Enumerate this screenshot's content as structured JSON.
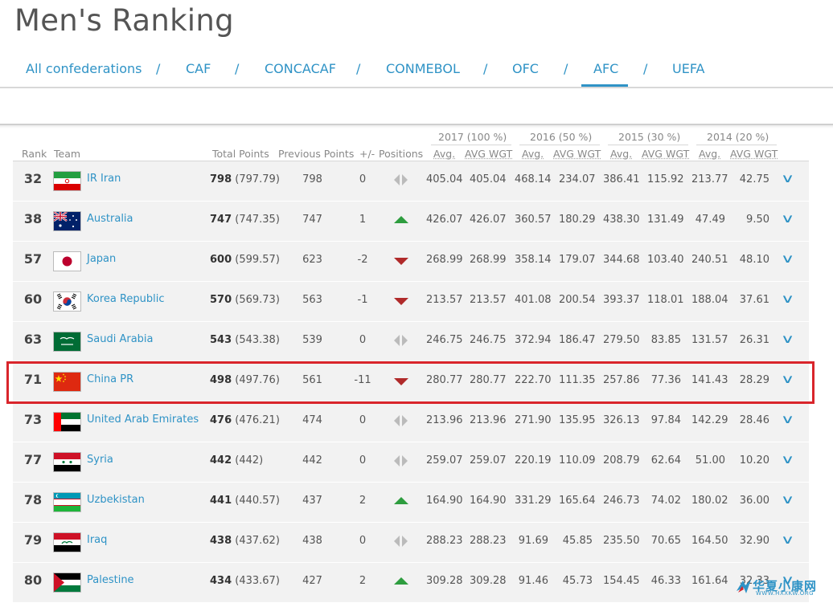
{
  "title": "Men's Ranking",
  "confederations": [
    {
      "label": "All confederations",
      "active": false
    },
    {
      "label": "CAF",
      "active": false
    },
    {
      "label": "CONCACAF",
      "active": false
    },
    {
      "label": "CONMEBOL",
      "active": false
    },
    {
      "label": "OFC",
      "active": false
    },
    {
      "label": "AFC",
      "active": true
    },
    {
      "label": "UEFA",
      "active": false
    }
  ],
  "separator": "/",
  "columns": {
    "rank": "Rank",
    "team": "Team",
    "total": "Total Points",
    "previous": "Previous Points",
    "diff": "+/-",
    "positions": "Positions"
  },
  "year_groups": [
    "2017 (100 %)",
    "2016 (50 %)",
    "2015 (30 %)",
    "2014 (20 %)"
  ],
  "sub_headers": [
    "Avg.",
    "AVG WGT"
  ],
  "rows": [
    {
      "rank": "32",
      "team": "IR Iran",
      "flag": "iran",
      "total": "798",
      "total_exact": "(797.79)",
      "prev": "798",
      "diff": "0",
      "move": "none",
      "y2017": [
        "405.04",
        "405.04"
      ],
      "y2016": [
        "468.14",
        "234.07"
      ],
      "y2015": [
        "386.41",
        "115.92"
      ],
      "y2014": [
        "213.77",
        "42.75"
      ]
    },
    {
      "rank": "38",
      "team": "Australia",
      "flag": "australia",
      "total": "747",
      "total_exact": "(747.35)",
      "prev": "747",
      "diff": "1",
      "move": "up",
      "y2017": [
        "426.07",
        "426.07"
      ],
      "y2016": [
        "360.57",
        "180.29"
      ],
      "y2015": [
        "438.30",
        "131.49"
      ],
      "y2014": [
        "47.49",
        "9.50"
      ]
    },
    {
      "rank": "57",
      "team": "Japan",
      "flag": "japan",
      "total": "600",
      "total_exact": "(599.57)",
      "prev": "623",
      "diff": "-2",
      "move": "down",
      "y2017": [
        "268.99",
        "268.99"
      ],
      "y2016": [
        "358.14",
        "179.07"
      ],
      "y2015": [
        "344.68",
        "103.40"
      ],
      "y2014": [
        "240.51",
        "48.10"
      ]
    },
    {
      "rank": "60",
      "team": "Korea Republic",
      "flag": "korea",
      "total": "570",
      "total_exact": "(569.73)",
      "prev": "563",
      "diff": "-1",
      "move": "down",
      "y2017": [
        "213.57",
        "213.57"
      ],
      "y2016": [
        "401.08",
        "200.54"
      ],
      "y2015": [
        "393.37",
        "118.01"
      ],
      "y2014": [
        "188.04",
        "37.61"
      ]
    },
    {
      "rank": "63",
      "team": "Saudi Arabia",
      "flag": "saudi",
      "total": "543",
      "total_exact": "(543.38)",
      "prev": "539",
      "diff": "0",
      "move": "none",
      "y2017": [
        "246.75",
        "246.75"
      ],
      "y2016": [
        "372.94",
        "186.47"
      ],
      "y2015": [
        "279.50",
        "83.85"
      ],
      "y2014": [
        "131.57",
        "26.31"
      ]
    },
    {
      "rank": "71",
      "team": "China PR",
      "flag": "china",
      "total": "498",
      "total_exact": "(497.76)",
      "prev": "561",
      "diff": "-11",
      "move": "down",
      "y2017": [
        "280.77",
        "280.77"
      ],
      "y2016": [
        "222.70",
        "111.35"
      ],
      "y2015": [
        "257.86",
        "77.36"
      ],
      "y2014": [
        "141.43",
        "28.29"
      ]
    },
    {
      "rank": "73",
      "team": "United Arab Emirates",
      "flag": "uae",
      "total": "476",
      "total_exact": "(476.21)",
      "prev": "474",
      "diff": "0",
      "move": "none",
      "y2017": [
        "213.96",
        "213.96"
      ],
      "y2016": [
        "271.90",
        "135.95"
      ],
      "y2015": [
        "326.13",
        "97.84"
      ],
      "y2014": [
        "142.29",
        "28.46"
      ]
    },
    {
      "rank": "77",
      "team": "Syria",
      "flag": "syria",
      "total": "442",
      "total_exact": "(442)",
      "prev": "442",
      "diff": "0",
      "move": "none",
      "y2017": [
        "259.07",
        "259.07"
      ],
      "y2016": [
        "220.19",
        "110.09"
      ],
      "y2015": [
        "208.79",
        "62.64"
      ],
      "y2014": [
        "51.00",
        "10.20"
      ]
    },
    {
      "rank": "78",
      "team": "Uzbekistan",
      "flag": "uzbekistan",
      "total": "441",
      "total_exact": "(440.57)",
      "prev": "437",
      "diff": "2",
      "move": "up",
      "y2017": [
        "164.90",
        "164.90"
      ],
      "y2016": [
        "331.29",
        "165.64"
      ],
      "y2015": [
        "246.73",
        "74.02"
      ],
      "y2014": [
        "180.02",
        "36.00"
      ]
    },
    {
      "rank": "79",
      "team": "Iraq",
      "flag": "iraq",
      "total": "438",
      "total_exact": "(437.62)",
      "prev": "438",
      "diff": "0",
      "move": "none",
      "y2017": [
        "288.23",
        "288.23"
      ],
      "y2016": [
        "91.69",
        "45.85"
      ],
      "y2015": [
        "235.50",
        "70.65"
      ],
      "y2014": [
        "164.50",
        "32.90"
      ]
    },
    {
      "rank": "80",
      "team": "Palestine",
      "flag": "palestine",
      "total": "434",
      "total_exact": "(433.67)",
      "prev": "427",
      "diff": "2",
      "move": "up",
      "y2017": [
        "309.28",
        "309.28"
      ],
      "y2016": [
        "91.46",
        "45.73"
      ],
      "y2015": [
        "154.45",
        "46.33"
      ],
      "y2014": [
        "161.64",
        "32.33"
      ]
    }
  ],
  "watermark": {
    "text": "华夏小康网",
    "sub": "WWW.HXXKW.ORG"
  },
  "colors": {
    "link": "#2f93c6",
    "up": "#2e9d3f",
    "down": "#b02a2a",
    "highlight": "#d9252b",
    "row_bg": "#f2f2f2"
  }
}
